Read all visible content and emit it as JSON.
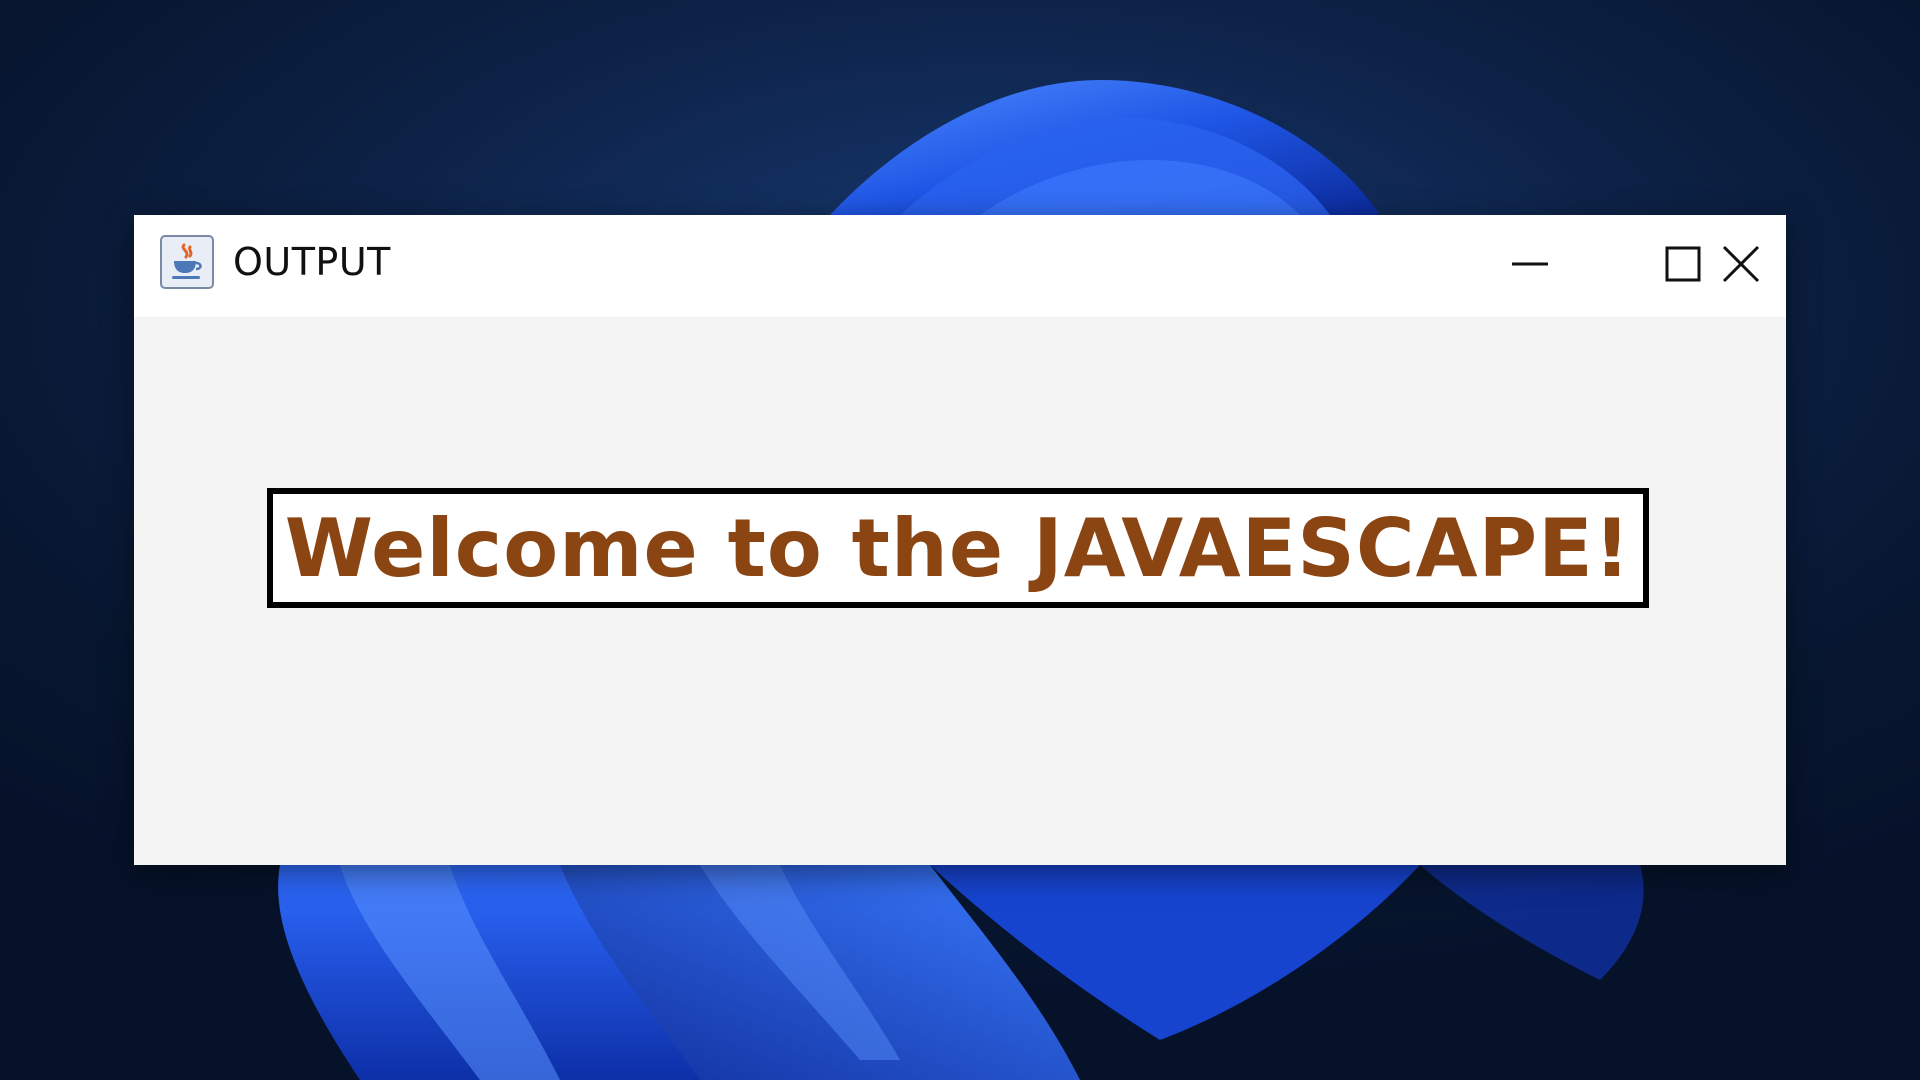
{
  "window": {
    "title": "OUTPUT",
    "app_icon": "java-cup-icon",
    "controls": {
      "minimize_icon": "minimize-icon",
      "maximize_icon": "maximize-icon",
      "close_icon": "close-icon"
    }
  },
  "content": {
    "label_text": "Welcome to the JAVAESCAPE!",
    "label_color": "#8b4513",
    "label_border_color": "#000000",
    "label_background": "#ffffff"
  },
  "colors": {
    "client_background": "#f4f4f4",
    "titlebar_background": "#ffffff",
    "desktop_background": "#0a1a38",
    "wallpaper_accent": "#1f56e6"
  }
}
